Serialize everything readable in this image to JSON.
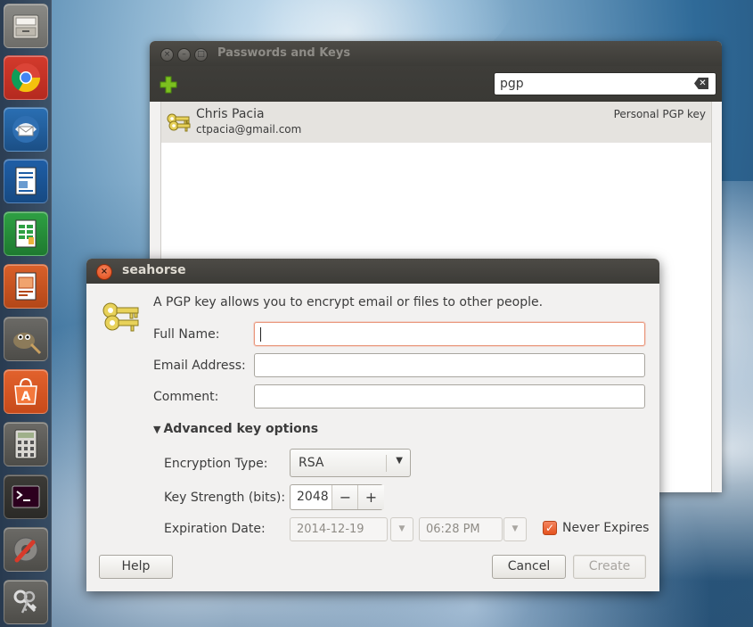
{
  "launcher": {
    "items": [
      {
        "name": "files-icon"
      },
      {
        "name": "chrome-icon"
      },
      {
        "name": "thunderbird-icon"
      },
      {
        "name": "writer-icon"
      },
      {
        "name": "calc-icon"
      },
      {
        "name": "impress-icon"
      },
      {
        "name": "gimp-icon"
      },
      {
        "name": "software-center-icon"
      },
      {
        "name": "calculator-icon"
      },
      {
        "name": "terminal-icon"
      },
      {
        "name": "system-settings-icon"
      },
      {
        "name": "passwords-keys-icon"
      }
    ]
  },
  "main_window": {
    "title": "Passwords and Keys",
    "search": {
      "value": "pgp"
    },
    "keys": [
      {
        "name": "Chris Pacia",
        "email": "ctpacia@gmail.com",
        "type": "Personal PGP key"
      }
    ]
  },
  "dialog": {
    "title": "seahorse",
    "intro": "A PGP key allows you to encrypt email or files to other people.",
    "full_name_label": "Full Name:",
    "full_name_value": "",
    "email_label": "Email Address:",
    "email_value": "",
    "comment_label": "Comment:",
    "comment_value": "",
    "advanced_label": "Advanced key options",
    "encryption_type_label": "Encryption Type:",
    "encryption_type_value": "RSA",
    "key_strength_label": "Key Strength (bits):",
    "key_strength_value": "2048",
    "minus": "−",
    "plus": "+",
    "expiration_label": "Expiration Date:",
    "expiration_date": "2014-12-19",
    "expiration_time": "06:28 PM",
    "never_expires_label": "Never Expires",
    "never_expires_checked": true,
    "help_button": "Help",
    "cancel_button": "Cancel",
    "create_button": "Create"
  },
  "colors": {
    "accent": "#e4521e",
    "titlebar": "#3c3b37"
  }
}
